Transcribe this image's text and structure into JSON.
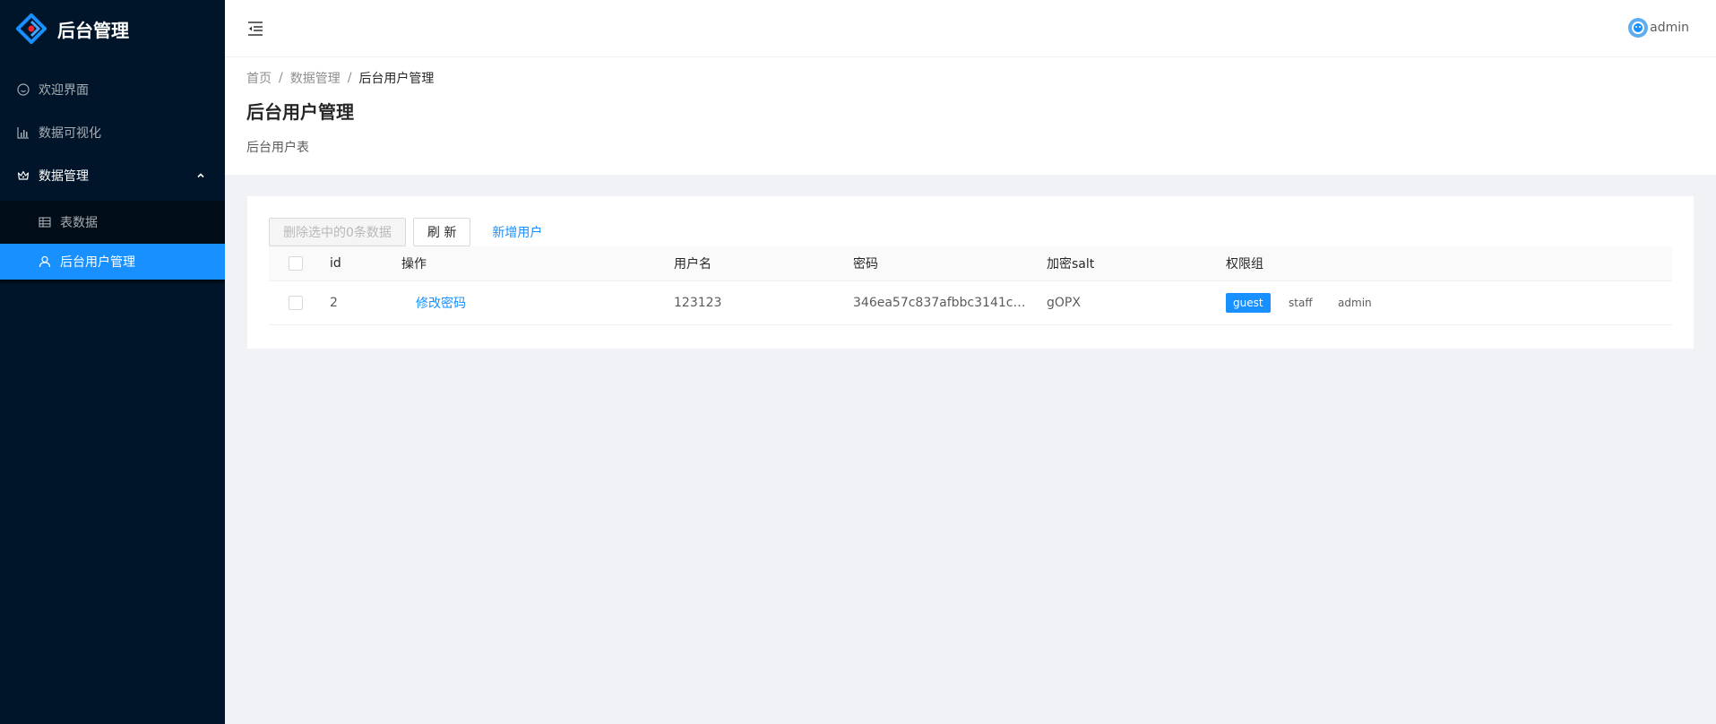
{
  "app": {
    "title": "后台管理"
  },
  "sidebar": {
    "items": [
      {
        "label": "欢迎界面",
        "icon": "smile-icon"
      },
      {
        "label": "数据可视化",
        "icon": "bar-chart-icon"
      },
      {
        "label": "数据管理",
        "icon": "crown-icon",
        "expanded": true,
        "children": [
          {
            "label": "表数据",
            "icon": "table-icon"
          },
          {
            "label": "后台用户管理",
            "icon": "user-icon",
            "selected": true
          }
        ]
      }
    ]
  },
  "header": {
    "username": "admin",
    "fold_icon": "menu-fold-icon"
  },
  "breadcrumb": [
    "首页",
    "数据管理",
    "后台用户管理"
  ],
  "page": {
    "title": "后台用户管理",
    "description": "后台用户表"
  },
  "toolbar": {
    "delete_label": "删除选中的0条数据",
    "refresh_label": "刷 新",
    "add_label": "新增用户"
  },
  "table": {
    "columns": [
      "id",
      "操作",
      "用户名",
      "密码",
      "加密salt",
      "权限组"
    ],
    "rows": [
      {
        "id": "2",
        "action": "修改密码",
        "username": "123123",
        "password": "346ea57c837afbbc3141cd771...",
        "salt": "gOPX",
        "roles": [
          {
            "label": "guest",
            "checked": true
          },
          {
            "label": "staff",
            "checked": false
          },
          {
            "label": "admin",
            "checked": false
          }
        ]
      }
    ]
  },
  "colors": {
    "primary": "#1890ff",
    "sider": "#001529",
    "submenu": "#000c17"
  }
}
